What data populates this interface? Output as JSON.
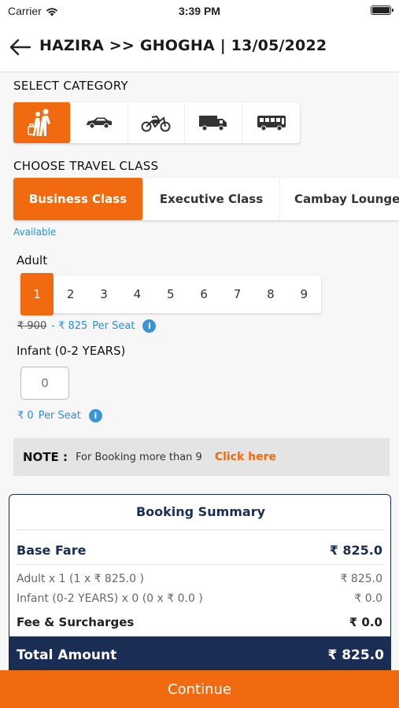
{
  "status": {
    "carrier": "Carrier",
    "time": "3:39 PM"
  },
  "header": {
    "title": "HAZIRA >> GHOGHA | 13/05/2022"
  },
  "category": {
    "title": "SELECT CATEGORY",
    "items": [
      {
        "icon": "passenger-icon",
        "active": true
      },
      {
        "icon": "car-icon",
        "active": false
      },
      {
        "icon": "motorcycle-icon",
        "active": false
      },
      {
        "icon": "truck-icon",
        "active": false
      },
      {
        "icon": "bus-icon",
        "active": false
      }
    ]
  },
  "travel_class": {
    "title": "CHOOSE TRAVEL CLASS",
    "items": [
      {
        "label": "Business Class",
        "active": true
      },
      {
        "label": "Executive Class",
        "active": false
      },
      {
        "label": "Cambay Lounge",
        "active": false
      }
    ],
    "availability": "Available"
  },
  "adult": {
    "label": "Adult",
    "options": [
      "1",
      "2",
      "3",
      "4",
      "5",
      "6",
      "7",
      "8",
      "9"
    ],
    "selected": "1",
    "old_price": "₹ 900",
    "new_price": "- ₹ 825",
    "per_seat": "Per Seat"
  },
  "infant": {
    "label": "Infant (0-2 YEARS)",
    "placeholder": "0",
    "price": "₹ 0",
    "per_seat": "Per Seat"
  },
  "note": {
    "label": "NOTE :",
    "text": "For Booking more than 9",
    "link": "Click here"
  },
  "summary": {
    "title": "Booking Summary",
    "base_fare_label": "Base Fare",
    "base_fare_value": "₹ 825.0",
    "adult_line": "Adult x 1 (1 x ₹ 825.0 )",
    "adult_value": "₹ 825.0",
    "infant_line": "Infant (0-2 YEARS) x 0 (0 x ₹ 0.0 )",
    "infant_value": "₹ 0.0",
    "fee_label": "Fee & Surcharges",
    "fee_value": "₹ 0.0",
    "total_label": "Total Amount",
    "total_value": "₹ 825.0"
  },
  "continue_label": "Continue",
  "colors": {
    "accent": "#f26a0f",
    "navy": "#1a2e55",
    "link": "#2a8fd8"
  }
}
